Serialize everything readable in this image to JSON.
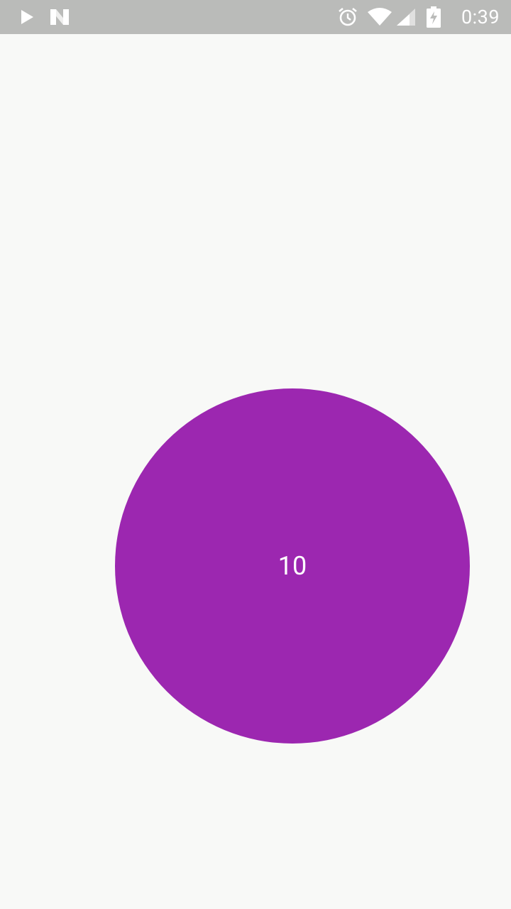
{
  "status_bar": {
    "time": "0:39",
    "background_color": "#babbb9",
    "icons_left": [
      "play-store-icon",
      "notification-n-icon"
    ],
    "icons_right": [
      "alarm-icon",
      "wifi-icon",
      "signal-icon",
      "battery-charging-icon"
    ]
  },
  "main": {
    "background_color": "#f8f9f7",
    "circle": {
      "label": "10",
      "color": "#9c27b0"
    }
  }
}
